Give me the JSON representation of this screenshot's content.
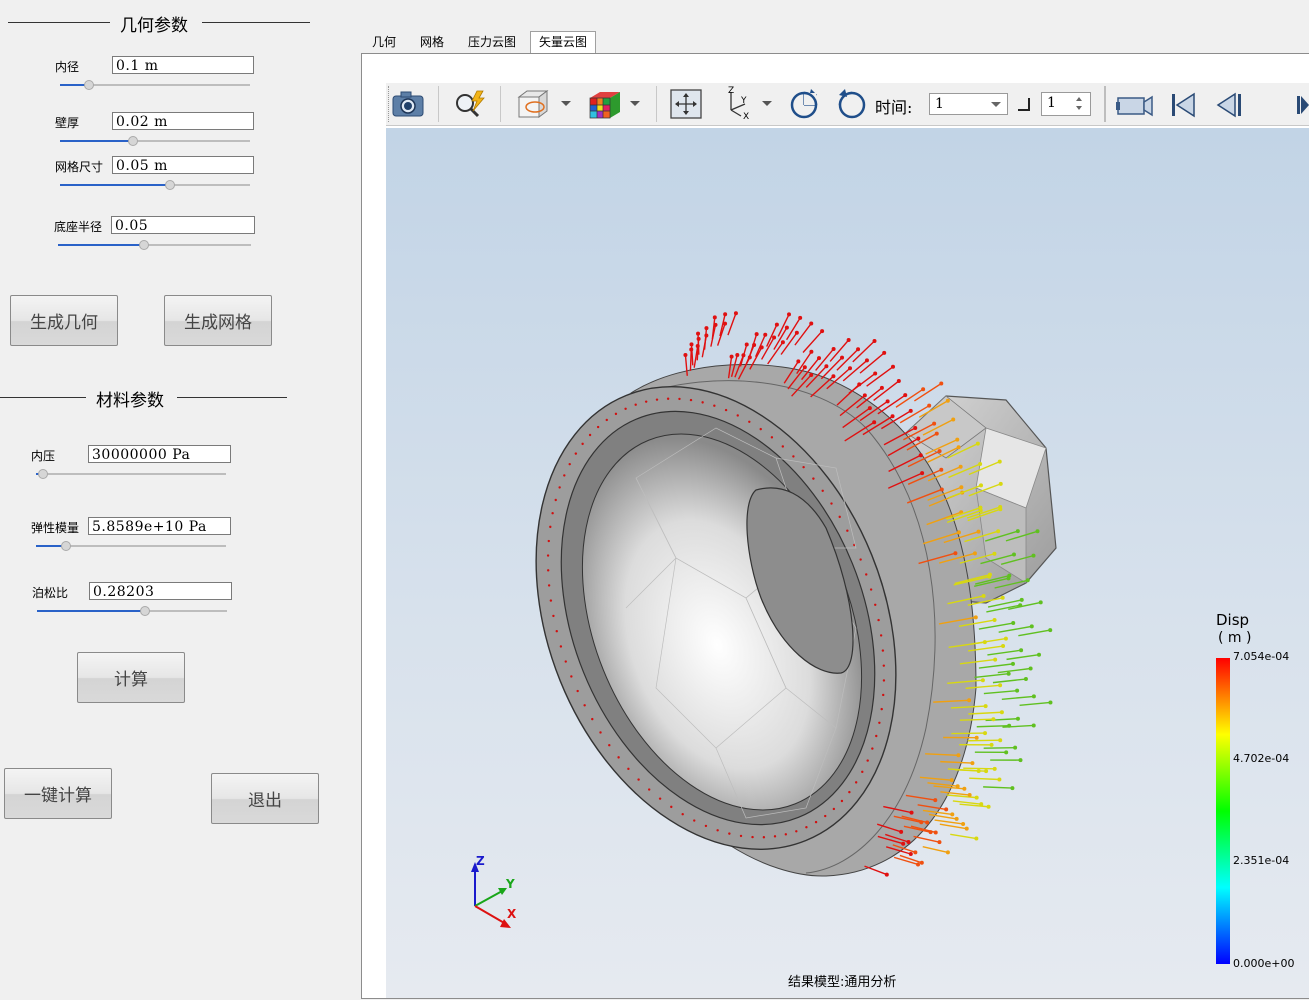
{
  "geometry_section": {
    "title": "几何参数",
    "params": [
      {
        "label": "内径",
        "value": "0.1 m",
        "slider": 0.2
      },
      {
        "label": "壁厚",
        "value": "0.02 m",
        "slider": 0.4
      },
      {
        "label": "网格尺寸",
        "value": "0.05 m",
        "slider": 0.58
      },
      {
        "label": "底座半径",
        "value": "0.05",
        "slider": 0.45
      }
    ],
    "generate_geometry_button": "生成几何",
    "generate_mesh_button": "生成网格"
  },
  "material_section": {
    "title": "材料参数",
    "params": [
      {
        "label": "内压",
        "value": "30000000 Pa",
        "slider": 0.05
      },
      {
        "label": "弹性模量",
        "value": "5.8589e+10 Pa",
        "slider": 0.16
      },
      {
        "label": "泊松比",
        "value": "0.28203",
        "slider": 0.56
      }
    ],
    "compute_button": "计算"
  },
  "one_click_button": "一键计算",
  "exit_button": "退出",
  "tabs": [
    {
      "label": "几何",
      "active": false
    },
    {
      "label": "网格",
      "active": false
    },
    {
      "label": "压力云图",
      "active": false
    },
    {
      "label": "矢量云图",
      "active": true
    }
  ],
  "toolbar": {
    "icons": [
      "camera-icon",
      "magnifier-icon",
      "display-mode-icon",
      "color-cube-icon",
      "fit-view-icon",
      "axes-icon",
      "rotate-cw-icon",
      "rotate-ccw-icon",
      "record-icon",
      "first-frame-icon",
      "prev-frame-icon",
      "next-frame-icon"
    ],
    "time_label": "时间:",
    "time_value": "1",
    "step_value": "1"
  },
  "viewport": {
    "status_text": "结果模型:通用分析",
    "axes": {
      "z": "Z",
      "y": "Y",
      "x": "X"
    },
    "legend": {
      "title": "Disp",
      "unit": "( m )",
      "ticks": [
        "7.054e-04",
        "4.702e-04",
        "2.351e-04",
        "0.000e+00"
      ]
    },
    "colors": {
      "max": "#ff0000",
      "mid": "#00ff00",
      "min": "#0000ff"
    }
  }
}
